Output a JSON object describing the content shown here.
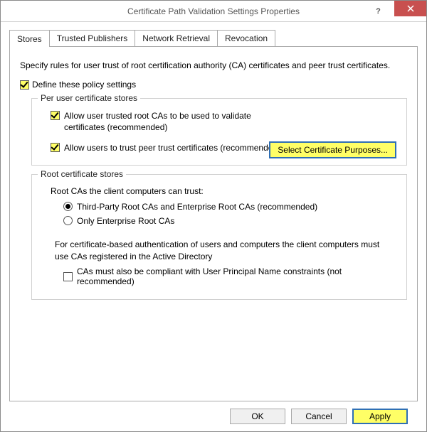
{
  "window": {
    "title": "Certificate Path Validation Settings Properties"
  },
  "tabs": {
    "t0": "Stores",
    "t1": "Trusted Publishers",
    "t2": "Network Retrieval",
    "t3": "Revocation"
  },
  "stores": {
    "intro": "Specify rules for user trust of root certification authority (CA) certificates and peer trust certificates.",
    "define_policy": "Define these policy settings",
    "per_user": {
      "legend": "Per user certificate stores",
      "opt1": "Allow user trusted root CAs to be used to validate certificates (recommended)",
      "opt2": "Allow users to trust peer trust certificates (recommended)",
      "select_btn": "Select Certificate Purposes..."
    },
    "root": {
      "legend": "Root certificate stores",
      "heading": "Root CAs the client computers can trust:",
      "r1": "Third-Party Root CAs and Enterprise Root CAs (recommended)",
      "r2": "Only Enterprise Root CAs",
      "dir_note": "For certificate-based authentication of users and computers the client computers must use CAs registered in the Active Directory",
      "compliant": "CAs must also be compliant with User Principal Name constraints (not recommended)"
    }
  },
  "buttons": {
    "ok": "OK",
    "cancel": "Cancel",
    "apply": "Apply"
  }
}
